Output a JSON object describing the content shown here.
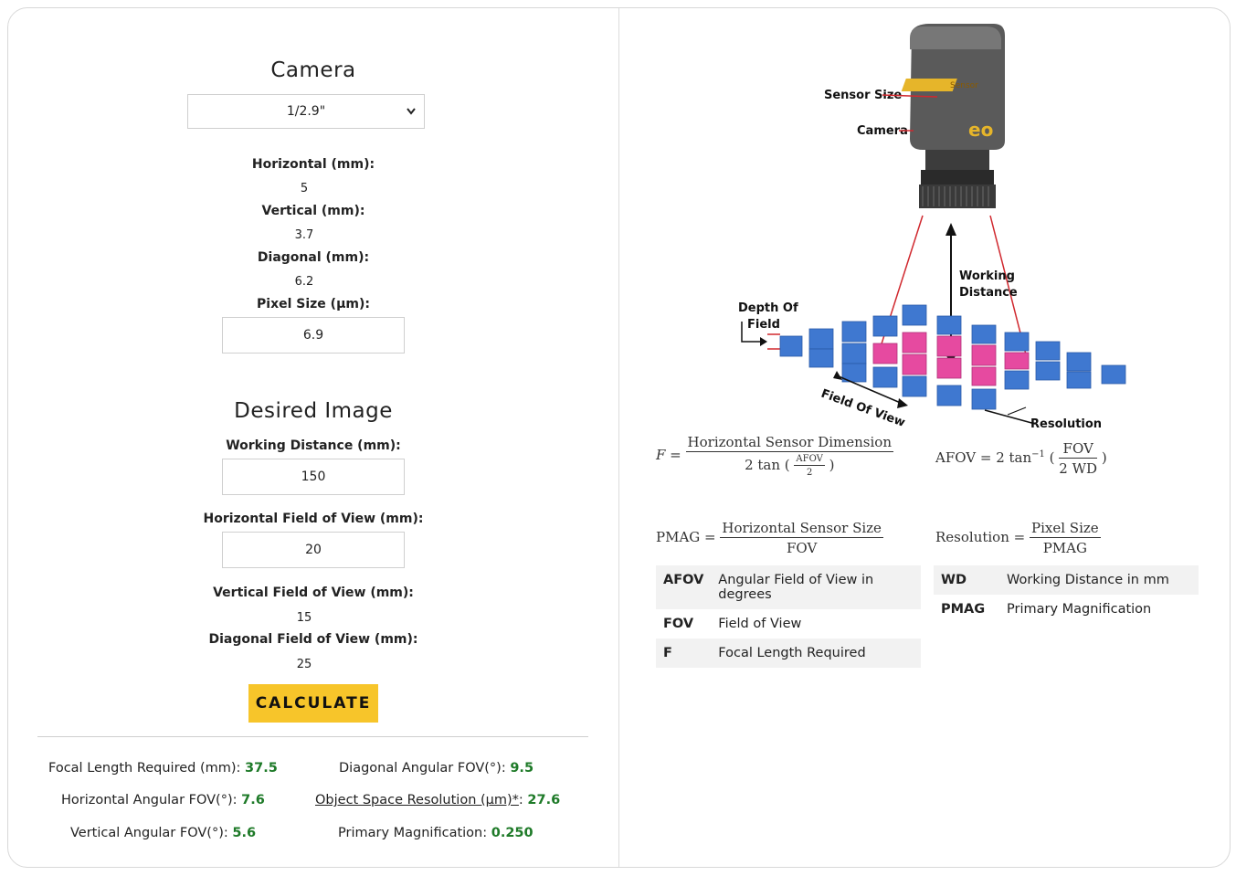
{
  "camera": {
    "title": "Camera",
    "sensor_select": "1/2.9\"",
    "horizontal_label": "Horizontal (mm):",
    "horizontal_value": "5",
    "vertical_label": "Vertical (mm):",
    "vertical_value": "3.7",
    "diagonal_label": "Diagonal (mm):",
    "diagonal_value": "6.2",
    "pixel_label": "Pixel Size (µm):",
    "pixel_value": "6.9"
  },
  "desired": {
    "title": "Desired Image",
    "wd_label": "Working Distance (mm):",
    "wd_value": "150",
    "hfov_label": "Horizontal Field of View (mm):",
    "hfov_value": "20",
    "vfov_label": "Vertical Field of View (mm):",
    "vfov_value": "15",
    "dfov_label": "Diagonal Field of View (mm):",
    "dfov_value": "25",
    "calculate": "CALCULATE"
  },
  "results": {
    "focal_label": "Focal Length Required (mm): ",
    "focal_value": "37.5",
    "dafov_label": "Diagonal Angular FOV(°): ",
    "dafov_value": "9.5",
    "hafov_label": "Horizontal Angular FOV(°): ",
    "hafov_value": "7.6",
    "osr_label": "Object Space Resolution (µm)*",
    "osr_value": "27.6",
    "vafov_label": "Vertical Angular FOV(°): ",
    "vafov_value": "5.6",
    "pmag_label": "Primary Magnification: ",
    "pmag_value": "0.250"
  },
  "illustration": {
    "sensor_size": "Sensor Size",
    "sensor": "Sensor",
    "camera": "Camera",
    "working_distance_1": "Working",
    "working_distance_2": "Distance",
    "depth_of_field_1": "Depth Of",
    "depth_of_field_2": "Field",
    "field_of_view": "Field Of View",
    "resolution": "Resolution"
  },
  "formulas": {
    "f_lhs": "F =",
    "f_num": "Horizontal Sensor Dimension",
    "f_den_pre": "2 tan",
    "f_den_num": "AFOV",
    "f_den_den": "2",
    "afov_lhs": "AFOV = 2 tan",
    "afov_sup": "−1",
    "afov_num": "FOV",
    "afov_den": "2 WD",
    "pmag_lhs": "PMAG =",
    "pmag_num": "Horizontal Sensor Size",
    "pmag_den": "FOV",
    "res_lhs": "Resolution =",
    "res_num": "Pixel Size",
    "res_den": "PMAG"
  },
  "glossary_left": [
    {
      "term": "AFOV",
      "def": "Angular Field of View in degrees"
    },
    {
      "term": "FOV",
      "def": "Field of View"
    },
    {
      "term": "F",
      "def": "Focal Length Required"
    }
  ],
  "glossary_right": [
    {
      "term": "WD",
      "def": "Working Distance in mm"
    },
    {
      "term": "PMAG",
      "def": "Primary Magnification"
    }
  ],
  "colors": {
    "accent": "#f7c52a",
    "result_value": "#1e7a28",
    "cube_blue": "#3f78d0",
    "cube_pink": "#e64aa0",
    "ray_red": "#d0282e"
  }
}
